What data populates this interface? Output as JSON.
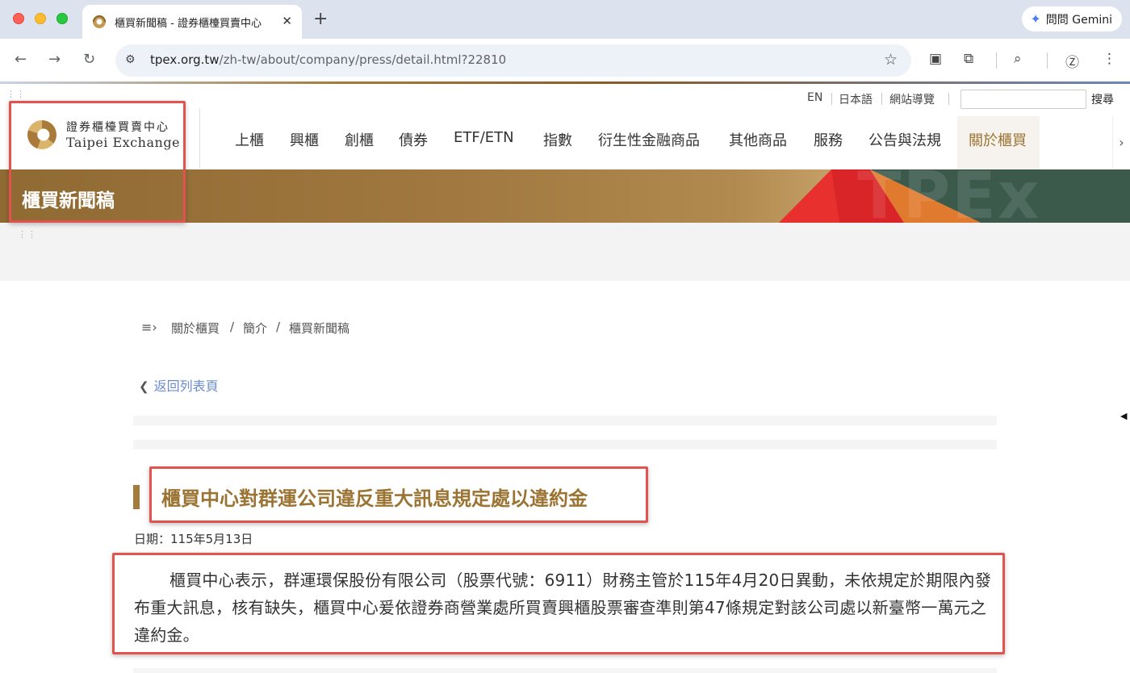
{
  "browser": {
    "tab_title": "櫃買新聞稿 - 證券櫃檯買賣中心",
    "tab_close": "✕",
    "new_tab": "+",
    "gemini_label": "問問 Gemini",
    "url_domain": "tpex.org.tw",
    "url_path": "/zh-tw/about/company/press/detail.html?22810"
  },
  "utility_nav": {
    "en": "EN",
    "ja": "日本語",
    "sitemap": "網站導覽",
    "search_value": "",
    "search_button": "搜尋"
  },
  "logo": {
    "chinese": "證券櫃檯買賣中心",
    "english": "Taipei Exchange"
  },
  "main_nav": [
    "上櫃",
    "興櫃",
    "創櫃",
    "債券",
    "ETF/ETN",
    "指數",
    "衍生性金融商品",
    "其他商品",
    "服務",
    "公告與法規",
    "關於櫃買"
  ],
  "banner": {
    "title": "櫃買新聞稿",
    "watermark": "TPEx"
  },
  "breadcrumb": [
    "關於櫃買",
    "簡介",
    "櫃買新聞稿"
  ],
  "breadcrumb_separator": "/",
  "back_link": "返回列表頁",
  "article": {
    "title": "櫃買中心對群運公司違反重大訊息規定處以違約金",
    "date": "日期：115年5月13日",
    "body": "櫃買中心表示，群運環保股份有限公司（股票代號：6911）財務主管於115年4月20日異動，未依規定於期限內發布重大訊息，核有缺失，櫃買中心爰依證券商營業處所買賣興櫃股票審查準則第47條規定對該公司處以新臺幣一萬元之違約金。"
  },
  "colors": {
    "brand_gold": "#9b7433",
    "banner_brown": "#8f6a32",
    "annotation_red": "#e2524f",
    "link_blue": "#6b8bd0"
  }
}
